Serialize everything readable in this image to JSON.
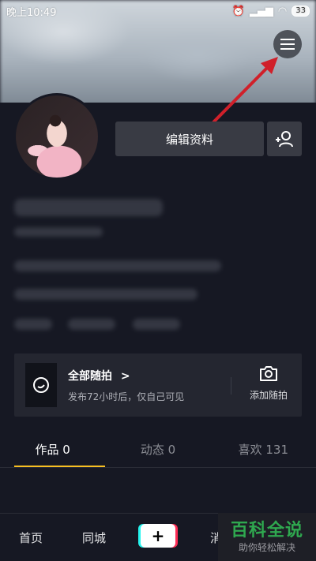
{
  "status_bar": {
    "time": "晚上10:49",
    "signal_text": "..ll",
    "battery": "33"
  },
  "profile": {
    "edit_label": "编辑资料"
  },
  "random_shoot": {
    "title": "全部随拍",
    "chevron": ">",
    "subtitle": "发布72小时后，仅自己可见",
    "add_label": "添加随拍"
  },
  "tabs": [
    {
      "label": "作品 0",
      "active": true
    },
    {
      "label": "动态 0",
      "active": false
    },
    {
      "label": "喜欢 131",
      "active": false
    }
  ],
  "bottom_nav": {
    "home": "首页",
    "local": "同城",
    "plus": "+",
    "partial": "消"
  },
  "watermark": {
    "title": "百科全说",
    "subtitle": "助你轻松解决"
  },
  "colors": {
    "background": "#161823",
    "tab_indicator": "#f8c022",
    "arrow": "#d0202a",
    "watermark_green": "#2fa84f"
  }
}
